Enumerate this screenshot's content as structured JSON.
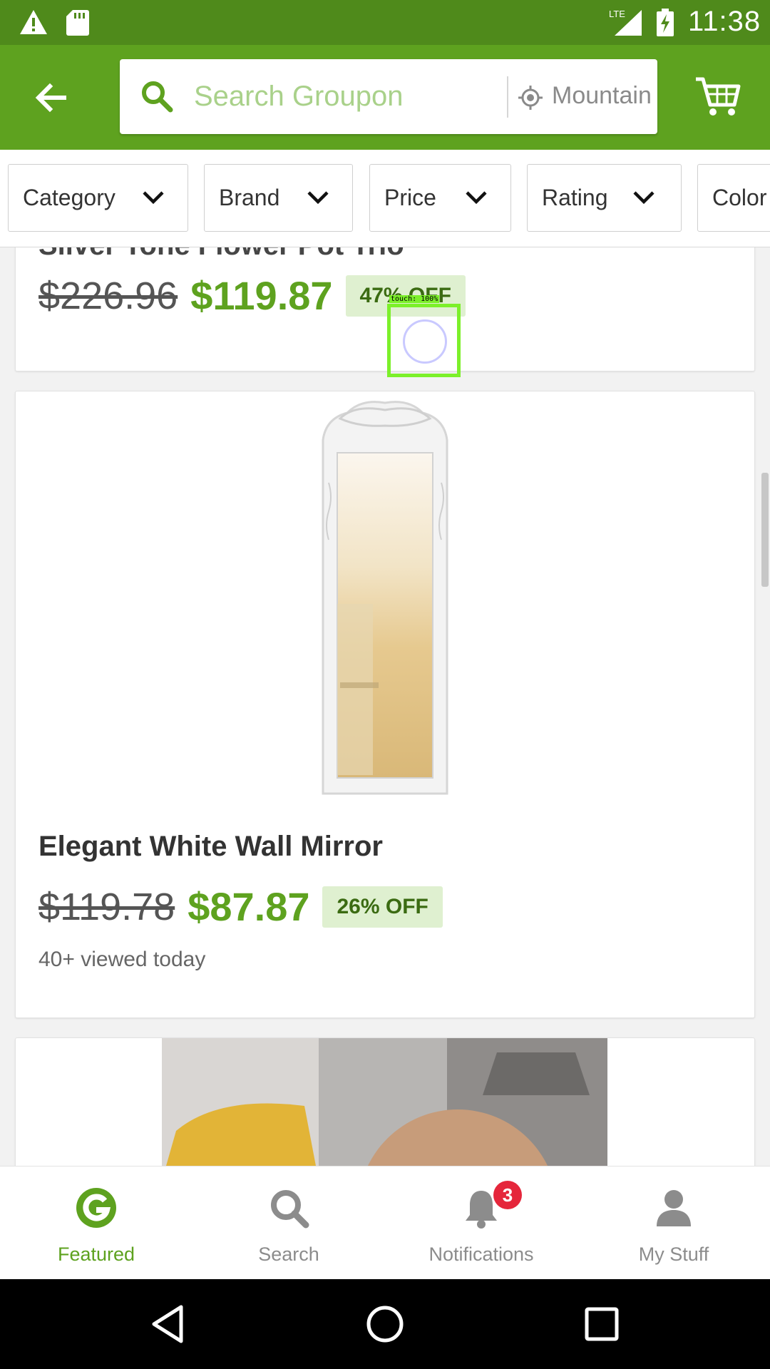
{
  "status_bar": {
    "time": "11:38",
    "network": "LTE",
    "icons": [
      "warning-icon",
      "sd-card-icon",
      "signal-icon",
      "battery-charging-icon"
    ]
  },
  "app_bar": {
    "search_placeholder": "Search Groupon",
    "location": "Mountain View",
    "icons": [
      "back-arrow-icon",
      "search-icon",
      "location-icon",
      "cart-icon"
    ],
    "accent_color": "#5ea21f"
  },
  "filters": [
    {
      "label": "Category"
    },
    {
      "label": "Brand"
    },
    {
      "label": "Price"
    },
    {
      "label": "Rating"
    },
    {
      "label": "Color"
    }
  ],
  "deals": [
    {
      "title": "Silver Tone Flower Pot Trio",
      "old_price": "$226.96",
      "new_price": "$119.87",
      "discount": "47% OFF"
    },
    {
      "title": "Elegant White Wall Mirror",
      "old_price": "$119.78",
      "new_price": "$87.87",
      "discount": "26% OFF",
      "viewed": "40+ viewed today"
    },
    {
      "title": ""
    }
  ],
  "touch_overlay": {
    "label": "touch: 100%"
  },
  "bottom_nav": {
    "items": [
      {
        "label": "Featured",
        "icon": "groupon-g-icon",
        "active": true
      },
      {
        "label": "Search",
        "icon": "search-icon"
      },
      {
        "label": "Notifications",
        "icon": "bell-icon",
        "badge": "3"
      },
      {
        "label": "My Stuff",
        "icon": "person-icon"
      }
    ]
  },
  "system_nav": {
    "icons": [
      "back-triangle-icon",
      "home-circle-icon",
      "recents-square-icon"
    ]
  }
}
